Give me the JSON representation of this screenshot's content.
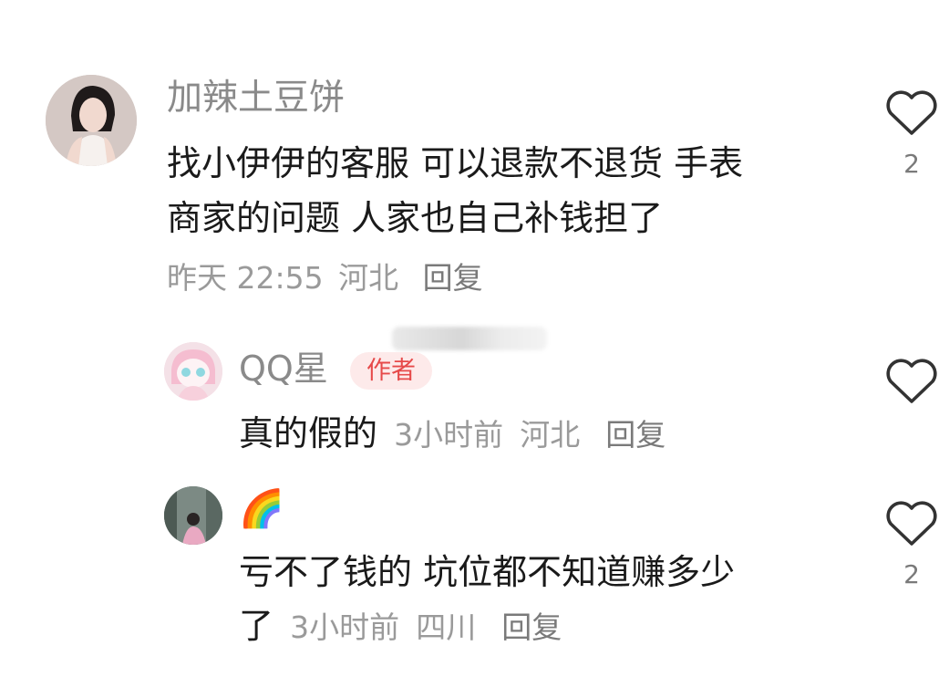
{
  "comments": [
    {
      "username": "加辣土豆饼",
      "text_line1": "找小伊伊的客服 可以退款不退货 手表",
      "text_line2": "商家的问题 人家也自己补钱担了",
      "time": "昨天 22:55",
      "location": "河北",
      "reply_label": "回复",
      "likes": "2"
    },
    {
      "username": "QQ星",
      "badge": "作者",
      "text": "真的假的",
      "time": "3小时前",
      "location": "河北",
      "reply_label": "回复"
    },
    {
      "username": "🌈",
      "text_line1": "亏不了钱的 坑位都不知道赚多少",
      "text_line2": "了",
      "time": "3小时前",
      "location": "四川",
      "reply_label": "回复",
      "likes": "2"
    }
  ],
  "icons": {
    "like": "heart-outline-icon"
  },
  "colors": {
    "badge_text": "#e64a4a",
    "badge_bg": "#fdeaea",
    "meta": "#9a9a9a"
  }
}
